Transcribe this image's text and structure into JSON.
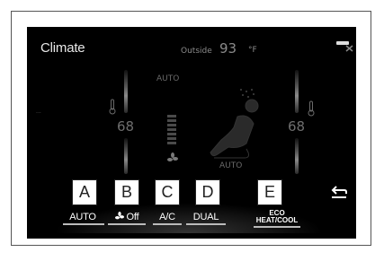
{
  "screen": {
    "title": "Climate",
    "outside_label": "Outside",
    "outside_temp": "93",
    "outside_unit": "°F",
    "temp_left": "68",
    "temp_right": "68",
    "auto_top": "AUTO",
    "auto_mid": "AUTO",
    "dots": "..."
  },
  "controls": [
    {
      "letter": "A",
      "label": "AUTO"
    },
    {
      "letter": "B",
      "label": "Off"
    },
    {
      "letter": "C",
      "label": "A/C"
    },
    {
      "letter": "D",
      "label": "DUAL"
    },
    {
      "letter": "E",
      "label_line1": "ECO",
      "label_line2": "HEAT/COOL"
    }
  ],
  "icons": {
    "fan": "fan-icon",
    "back": "back-arrow-icon",
    "seat": "seat-airflow-icon",
    "thermometer": "thermometer-icon",
    "top_right": "status-icon"
  }
}
